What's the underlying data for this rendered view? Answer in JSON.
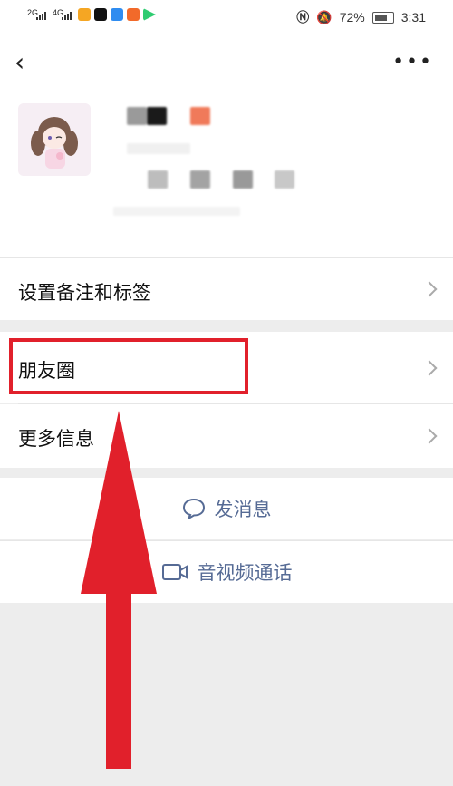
{
  "status_bar": {
    "sig1": "2G",
    "sig2": "4G",
    "battery": "72%",
    "time": "3:31"
  },
  "profile": {
    "avatar": "cartoon-girl-avatar"
  },
  "menu": {
    "remark_label": "设置备注和标签",
    "moments_label": "朋友圈",
    "more_info_label": "更多信息"
  },
  "actions": {
    "message_label": "发消息",
    "video_call_label": "音视频通话"
  },
  "colors": {
    "highlight": "#e1202b",
    "action_text": "#566b95",
    "arrow": "#e1202b"
  }
}
